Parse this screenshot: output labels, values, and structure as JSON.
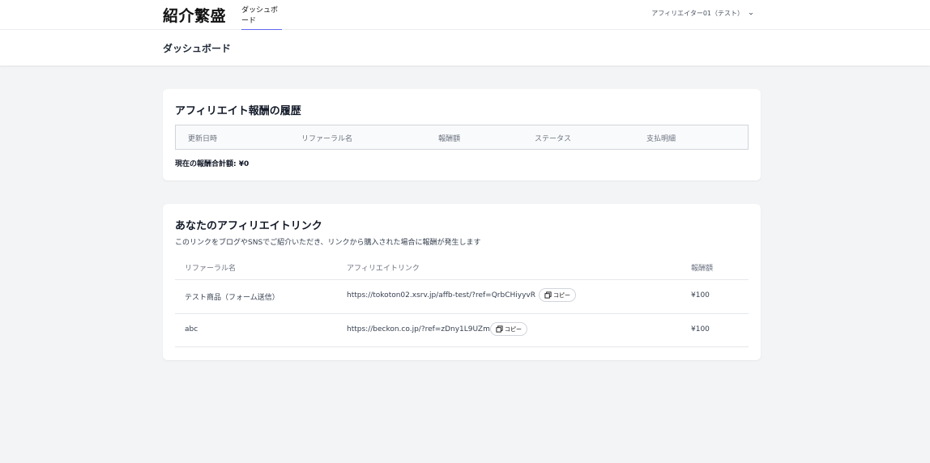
{
  "nav": {
    "logo": "紹介繁盛",
    "tab_dashboard": "ダッシュボード",
    "user_menu": "アフィリエイター01（テスト）"
  },
  "page": {
    "title": "ダッシュボード"
  },
  "history": {
    "title": "アフィリエイト報酬の履歴",
    "columns": [
      "更新日時",
      "リファーラル名",
      "報酬額",
      "ステータス",
      "支払明細"
    ],
    "total": "現在の報酬合計額: ¥0"
  },
  "links": {
    "title": "あなたのアフィリエイトリンク",
    "subtitle": "このリンクをブログやSNSでご紹介いただき、リンクから購入された場合に報酬が発生します",
    "columns": [
      "リファーラル名",
      "アフィリエイトリンク",
      "報酬額"
    ],
    "copy_label": "コピー",
    "rows": [
      {
        "name": "テスト商品（フォーム送信）",
        "url": "https://tokoton02.xsrv.jp/affb-test/?ref=QrbCHiyyvR",
        "amount": "¥100"
      },
      {
        "name": "abc",
        "url": "https://beckon.co.jp/?ref=zDny1L9UZm",
        "amount": "¥100"
      }
    ]
  },
  "colors": {
    "accent": "#6366f1",
    "background": "#f3f4f6"
  }
}
